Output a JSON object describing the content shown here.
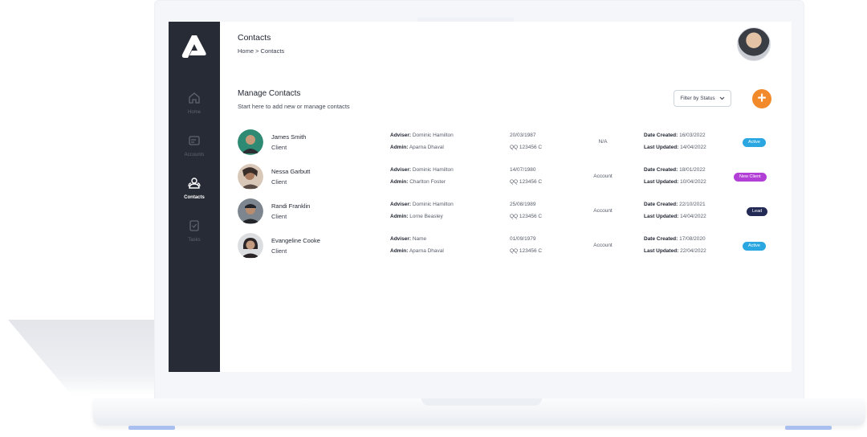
{
  "sidebar": {
    "items": [
      {
        "label": "Home",
        "icon": "home-icon",
        "active": false
      },
      {
        "label": "Accounts",
        "icon": "accounts-icon",
        "active": false
      },
      {
        "label": "Contacts",
        "icon": "contacts-icon",
        "active": true
      },
      {
        "label": "Tasks",
        "icon": "tasks-icon",
        "active": false
      }
    ]
  },
  "header": {
    "title": "Contacts",
    "breadcrumb": "Home > Contacts"
  },
  "section": {
    "title": "Manage Contacts",
    "subtitle": "Start here to add new or manage contacts",
    "filter_label": "Filter by Status",
    "add_label": "+"
  },
  "labels": {
    "adviser": "Adviser:",
    "admin": "Admin:",
    "date_created": "Date Created:",
    "last_updated": "Last Updated:"
  },
  "contacts": [
    {
      "name": "James Smith",
      "role": "Client",
      "adviser": "Dominic Hamilton",
      "admin": "Aparna Dhaval",
      "dob": "20/03/1987",
      "ni": "QQ 123456 C",
      "type": "N/A",
      "created": "16/03/2022",
      "updated": "14/04/2022",
      "status": "Active",
      "status_color": "#2aa7e0"
    },
    {
      "name": "Nessa Garbutt",
      "role": "Client",
      "adviser": "Dominic Hamilton",
      "admin": "Charlton Foster",
      "dob": "14/07/1980",
      "ni": "QQ 123456 C",
      "type": "Account",
      "created": "18/01/2022",
      "updated": "10/04/2022",
      "status": "New Client",
      "status_color": "#b23fd6"
    },
    {
      "name": "Randi Franklin",
      "role": "Client",
      "adviser": "Dominic Hamilton",
      "admin": "Lorne Beasley",
      "dob": "25/08/1989",
      "ni": "QQ 123456 C",
      "type": "Account",
      "created": "22/10/2021",
      "updated": "14/04/2022",
      "status": "Lead",
      "status_color": "#222a55"
    },
    {
      "name": "Evangeline Cooke",
      "role": "Client",
      "adviser": "Name",
      "admin": "Aparna Dhaval",
      "dob": "01/09/1979",
      "ni": "QQ 123456 C",
      "type": "Account",
      "created": "17/08/2020",
      "updated": "22/04/2022",
      "status": "Active",
      "status_color": "#2aa7e0"
    }
  ]
}
